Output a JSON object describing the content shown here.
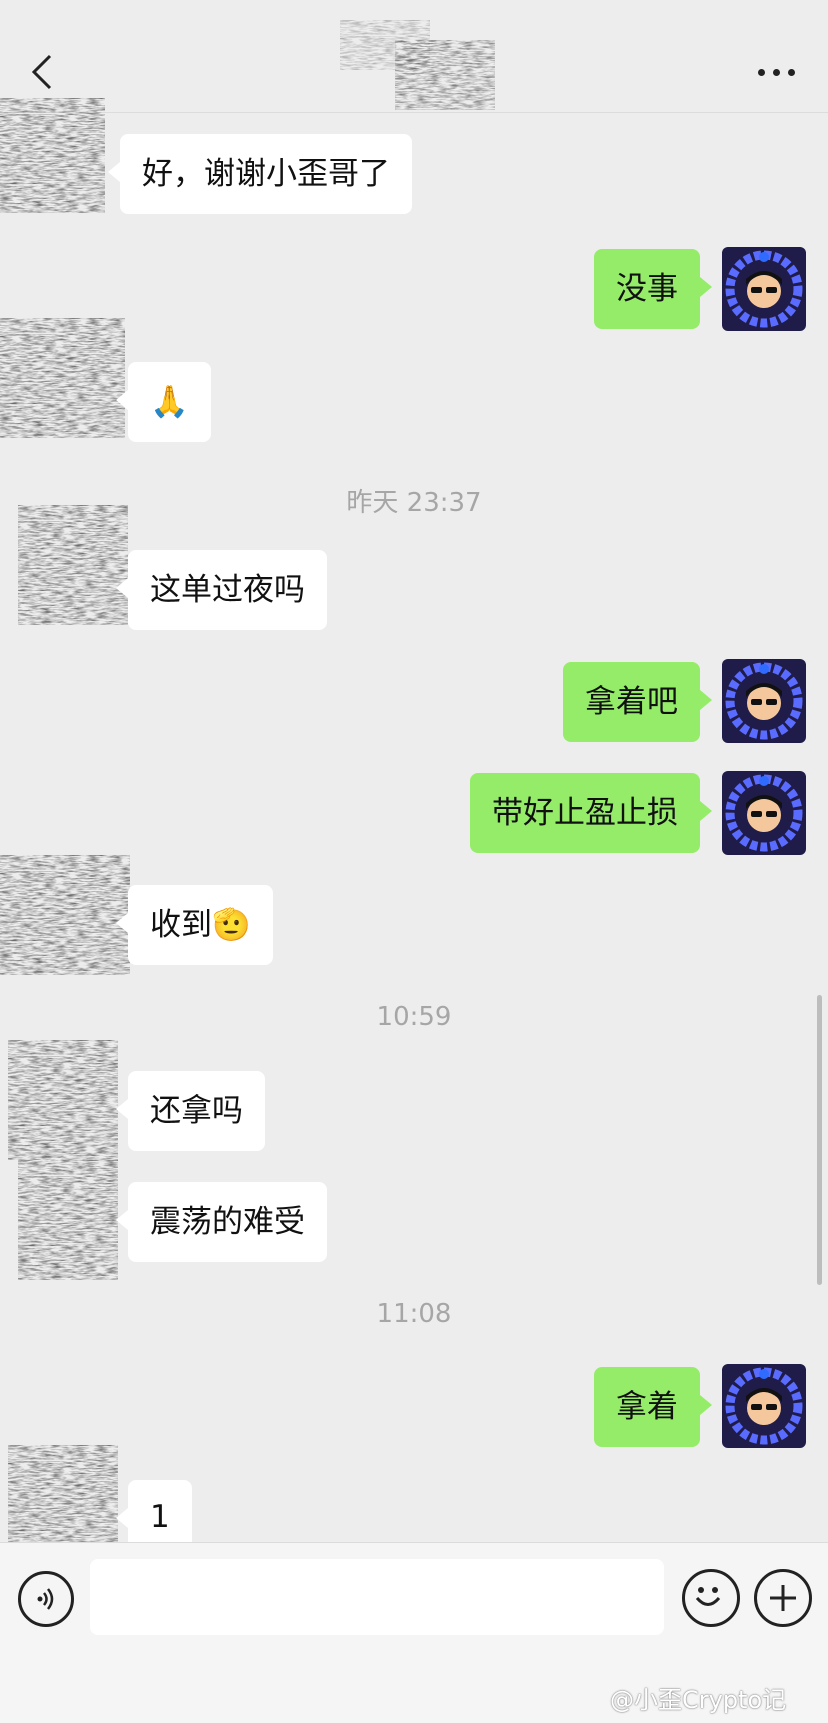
{
  "header": {
    "back_icon": "chevron-left-icon",
    "more_icon": "ellipsis-icon"
  },
  "messages": [
    {
      "side": "in",
      "text": "好，谢谢小歪哥了"
    },
    {
      "side": "out",
      "text": "没事"
    },
    {
      "side": "in",
      "text": "🙏"
    },
    {
      "side": "in",
      "text": "这单过夜吗"
    },
    {
      "side": "out",
      "text": "拿着吧"
    },
    {
      "side": "out",
      "text": "带好止盈止损"
    },
    {
      "side": "in",
      "text": "收到🫡"
    },
    {
      "side": "in",
      "text": "还拿吗"
    },
    {
      "side": "in",
      "text": "震荡的难受"
    },
    {
      "side": "out",
      "text": "拿着"
    },
    {
      "side": "in",
      "text": "1"
    }
  ],
  "timestamps": [
    "昨天 23:37",
    "10:59",
    "11:08"
  ],
  "input": {
    "value": "",
    "placeholder": ""
  },
  "toolbar_icons": {
    "voice": "voice-icon",
    "emoji": "emoji-icon",
    "plus": "plus-icon"
  },
  "watermark": "@小歪Crypto记",
  "colors": {
    "background": "#ededed",
    "incoming": "#ffffff",
    "outgoing": "#95ec69",
    "timestamp": "#a6a6a6"
  }
}
